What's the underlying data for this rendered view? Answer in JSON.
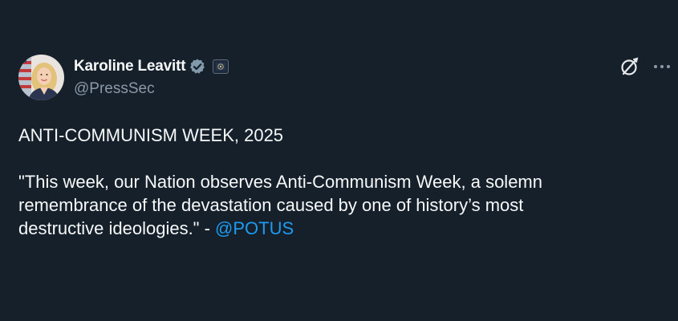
{
  "user": {
    "display_name": "Karoline Leavitt",
    "handle": "@PressSec",
    "verified_icon": "verified-badge-icon",
    "affiliate_icon": "affiliate-badge-icon",
    "avatar_icon": "profile-avatar"
  },
  "actions": {
    "grok_icon": "grok-icon",
    "more_icon": "more-options-icon"
  },
  "tweet": {
    "headline": "ANTI-COMMUNISM WEEK, 2025",
    "quote_line1": "\"This week, our Nation observes Anti-Communism Week, a solemn",
    "quote_line2": "remembrance of the devastation caused by one of history’s most",
    "quote_line3": "destructive ideologies.\" - ",
    "mention": "@POTUS"
  },
  "colors": {
    "background": "#15202b",
    "text": "#f7f9f9",
    "secondary_text": "#8b98a5",
    "link": "#1d9bf0",
    "verified": "#829aab"
  }
}
